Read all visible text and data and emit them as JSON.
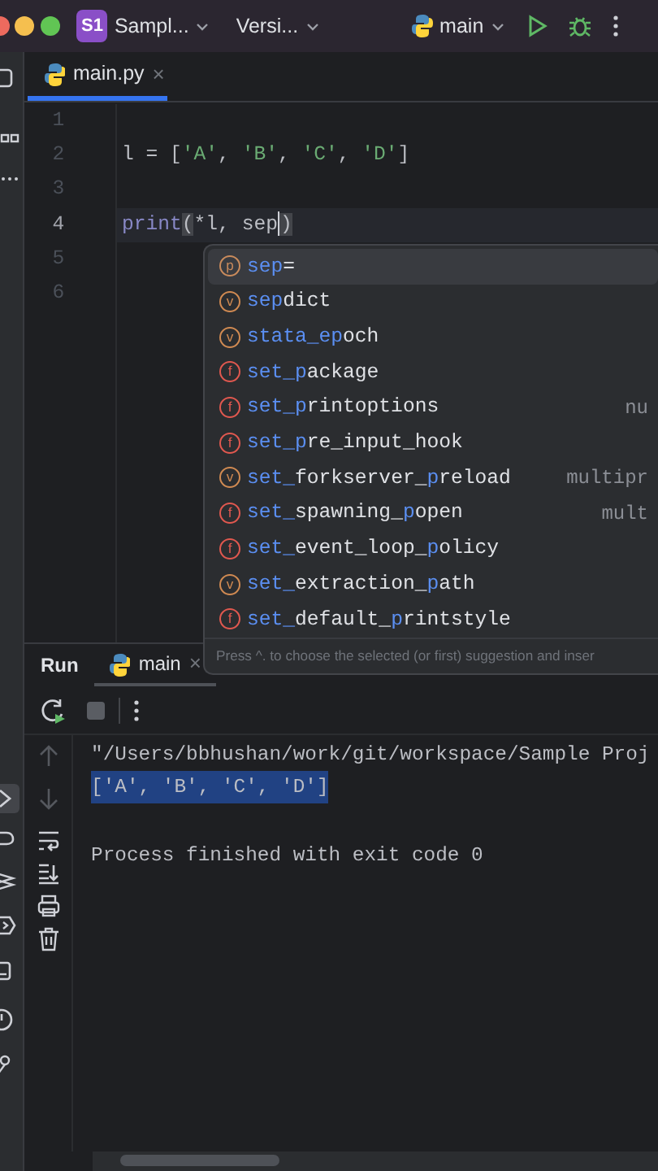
{
  "title_bar": {
    "project_badge": "S1",
    "project": "Sampl...",
    "vcs": "Versi...",
    "run_config": "main"
  },
  "editor_tab": {
    "label": "main.py",
    "close": "×",
    "selected": true
  },
  "code_lines": [
    {
      "number": "1",
      "current": false
    },
    {
      "number": "2",
      "current": false,
      "tokens": [
        {
          "text": "l = [",
          "kind": "plain"
        },
        {
          "text": "'A'",
          "kind": "string"
        },
        {
          "text": ", ",
          "kind": "plain"
        },
        {
          "text": "'B'",
          "kind": "string"
        },
        {
          "text": ", ",
          "kind": "plain"
        },
        {
          "text": "'C'",
          "kind": "string"
        },
        {
          "text": ", ",
          "kind": "plain"
        },
        {
          "text": "'D'",
          "kind": "string"
        },
        {
          "text": "]",
          "kind": "plain"
        }
      ]
    },
    {
      "number": "3",
      "current": false
    },
    {
      "number": "4",
      "current": true,
      "tokens": [
        {
          "text": "print",
          "kind": "builtin"
        },
        {
          "text": "(",
          "kind": "brace"
        },
        {
          "text": "*l, sep",
          "kind": "plain",
          "caret_after": true
        },
        {
          "text": ")",
          "kind": "brace"
        }
      ]
    },
    {
      "number": "5",
      "current": false
    },
    {
      "number": "6",
      "current": false
    }
  ],
  "completion": {
    "items": [
      {
        "kind": "parameter",
        "icon": "p",
        "selected": true,
        "parts": [
          {
            "t": "sep",
            "m": true
          },
          {
            "t": "=",
            "m": false
          }
        ]
      },
      {
        "kind": "variable",
        "icon": "v",
        "selected": false,
        "parts": [
          {
            "t": "sep",
            "m": true
          },
          {
            "t": "dict",
            "m": false
          }
        ]
      },
      {
        "kind": "variable",
        "icon": "v",
        "selected": false,
        "parts": [
          {
            "t": "stata_ep",
            "m": true
          },
          {
            "t": "och",
            "m": false
          }
        ]
      },
      {
        "kind": "function",
        "icon": "f",
        "selected": false,
        "parts": [
          {
            "t": "set_p",
            "m": true
          },
          {
            "t": "ackage",
            "m": false
          }
        ]
      },
      {
        "kind": "function",
        "icon": "f",
        "selected": false,
        "parts": [
          {
            "t": "set_p",
            "m": true
          },
          {
            "t": "rintoptions",
            "m": false
          }
        ],
        "hint": "nu"
      },
      {
        "kind": "function",
        "icon": "f",
        "selected": false,
        "parts": [
          {
            "t": "set_p",
            "m": true
          },
          {
            "t": "re_input_hook",
            "m": false
          }
        ]
      },
      {
        "kind": "variable",
        "icon": "v",
        "selected": false,
        "parts": [
          {
            "t": "set_",
            "m": true
          },
          {
            "t": "forkserver_",
            "m": false
          },
          {
            "t": "p",
            "m": true
          },
          {
            "t": "reload",
            "m": false
          }
        ],
        "hint": "multipr"
      },
      {
        "kind": "function",
        "icon": "f",
        "selected": false,
        "parts": [
          {
            "t": "set_",
            "m": true
          },
          {
            "t": "spawning_",
            "m": false
          },
          {
            "t": "p",
            "m": true
          },
          {
            "t": "open",
            "m": false
          }
        ],
        "hint": "mult"
      },
      {
        "kind": "function",
        "icon": "f",
        "selected": false,
        "parts": [
          {
            "t": "set_",
            "m": true
          },
          {
            "t": "event_loop_",
            "m": false
          },
          {
            "t": "p",
            "m": true
          },
          {
            "t": "olicy",
            "m": false
          }
        ]
      },
      {
        "kind": "variable",
        "icon": "v",
        "selected": false,
        "parts": [
          {
            "t": "set_",
            "m": true
          },
          {
            "t": "extraction_",
            "m": false
          },
          {
            "t": "p",
            "m": true
          },
          {
            "t": "ath",
            "m": false
          }
        ]
      },
      {
        "kind": "function",
        "icon": "f",
        "selected": false,
        "parts": [
          {
            "t": "set_",
            "m": true
          },
          {
            "t": "default_",
            "m": false
          },
          {
            "t": "p",
            "m": true
          },
          {
            "t": "rintstyle",
            "m": false
          }
        ]
      }
    ],
    "footer": "Press ^. to choose the selected (or first) suggestion and inser"
  },
  "run_panel": {
    "title": "Run",
    "tab": {
      "label": "main",
      "close": "×",
      "selected": true
    },
    "console": [
      {
        "kind": "output",
        "text": "\"/Users/bbhushan/work/git/workspace/Sample Proj",
        "selected": false
      },
      {
        "kind": "output",
        "text": "['A', 'B', 'C', 'D']",
        "selected": true
      },
      {
        "kind": "status",
        "text": "Process finished with exit code 0",
        "selected": false
      }
    ]
  }
}
